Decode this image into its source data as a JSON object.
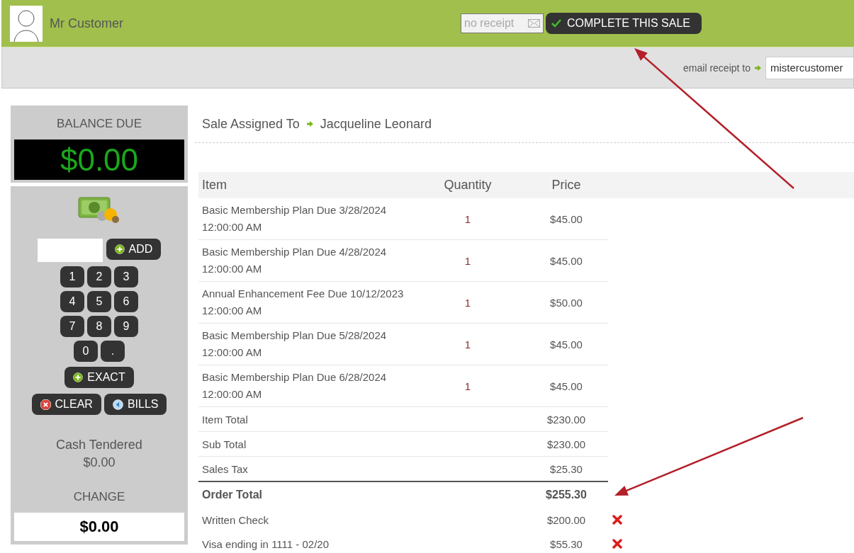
{
  "customer": {
    "name": "Mr Customer"
  },
  "receipt": {
    "placeholder": "no receipt"
  },
  "complete_button": {
    "label": "COMPLETE THIS SALE"
  },
  "email": {
    "label": "email receipt to",
    "value": "mistercustomer"
  },
  "balance": {
    "label": "BALANCE DUE",
    "amount": "$0.00"
  },
  "keypad": {
    "add": "ADD",
    "keys": [
      "1",
      "2",
      "3",
      "4",
      "5",
      "6",
      "7",
      "8",
      "9",
      "0",
      "."
    ],
    "exact": "EXACT",
    "clear": "CLEAR",
    "bills": "BILLS"
  },
  "cash": {
    "label": "Cash Tendered",
    "amount": "$0.00"
  },
  "change": {
    "label": "CHANGE",
    "amount": "$0.00"
  },
  "sale": {
    "label": "Sale Assigned To",
    "assignee": "Jacqueline Leonard"
  },
  "table": {
    "columns": [
      "Item",
      "Quantity",
      "Price"
    ],
    "rows": [
      {
        "item": "Basic Membership Plan Due 3/28/2024 12:00:00 AM",
        "quantity": "1",
        "price": "$45.00"
      },
      {
        "item": "Basic Membership Plan Due 4/28/2024 12:00:00 AM",
        "quantity": "1",
        "price": "$45.00"
      },
      {
        "item": "Annual Enhancement Fee Due 10/12/2023 12:00:00 AM",
        "quantity": "1",
        "price": "$50.00"
      },
      {
        "item": "Basic Membership Plan Due 5/28/2024 12:00:00 AM",
        "quantity": "1",
        "price": "$45.00"
      },
      {
        "item": "Basic Membership Plan Due 6/28/2024 12:00:00 AM",
        "quantity": "1",
        "price": "$45.00"
      }
    ],
    "totals": [
      {
        "label": "Item Total",
        "amount": "$230.00",
        "kind": "subtotal"
      },
      {
        "label": "Sub Total",
        "amount": "$230.00",
        "kind": "subtotal"
      },
      {
        "label": "Sales Tax",
        "amount": "$25.30",
        "kind": "subtotal"
      },
      {
        "label": "Order Total",
        "amount": "$255.30",
        "kind": "grand"
      }
    ],
    "payments": [
      {
        "label": "Written Check",
        "amount": "$200.00"
      },
      {
        "label": "Visa ending in 1111 - 02/20",
        "amount": "$55.30"
      }
    ]
  }
}
